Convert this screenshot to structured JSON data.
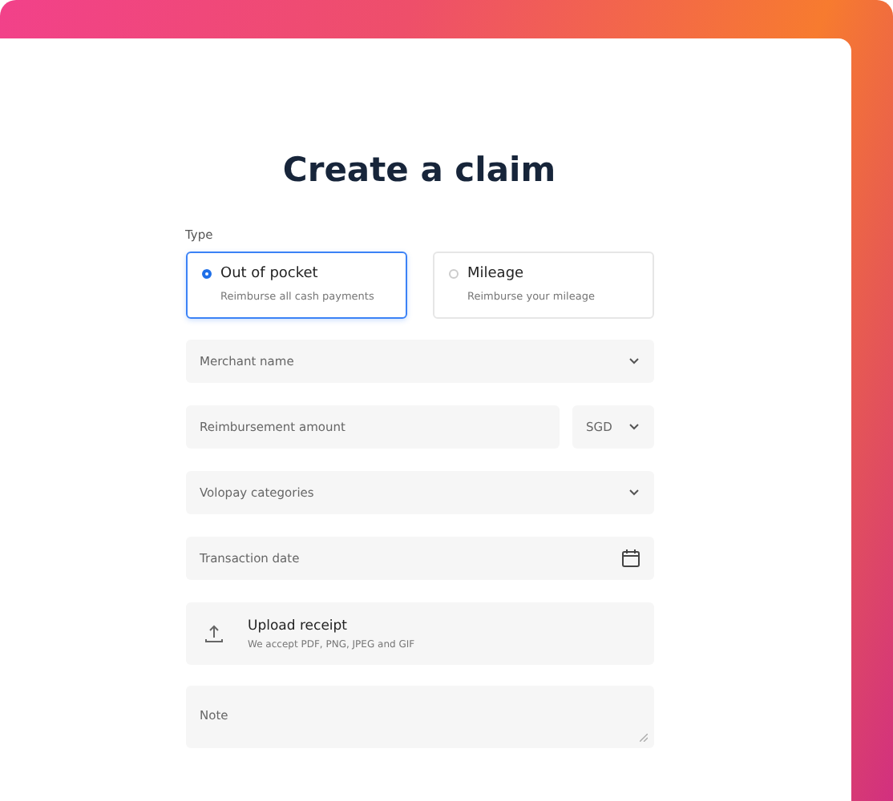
{
  "title": "Create a claim",
  "type_label": "Type",
  "claim_types": [
    {
      "label": "Out of pocket",
      "description": "Reimburse all cash payments",
      "selected": true
    },
    {
      "label": "Mileage",
      "description": "Reimburse your mileage",
      "selected": false
    }
  ],
  "merchant": {
    "placeholder": "Merchant name"
  },
  "amount": {
    "placeholder": "Reimbursement amount",
    "currency": "SGD"
  },
  "categories": {
    "placeholder": "Volopay categories"
  },
  "date": {
    "placeholder": "Transaction date"
  },
  "upload": {
    "title": "Upload receipt",
    "hint": "We accept PDF, PNG, JPEG and GIF"
  },
  "note": {
    "placeholder": "Note"
  }
}
